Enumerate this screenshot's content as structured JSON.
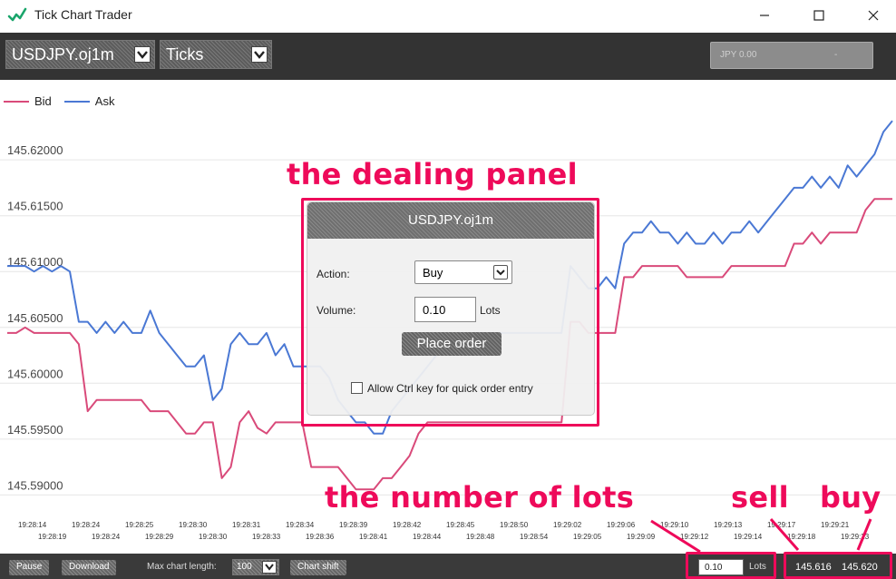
{
  "window": {
    "title": "Tick Chart Trader",
    "controls": {
      "minimize": "—",
      "maximize": "☐",
      "close": "✕"
    }
  },
  "toolbar": {
    "symbol": "USDJPY.oj1m",
    "timeframe": "Ticks",
    "balance": "JPY 0.00",
    "balance_dash": "-"
  },
  "legend": {
    "bid": {
      "label": "Bid",
      "color": "#d94a7a"
    },
    "ask": {
      "label": "Ask",
      "color": "#4a78d4"
    }
  },
  "chart_data": {
    "type": "line",
    "y_ticks": [
      "145.62000",
      "145.61500",
      "145.61000",
      "145.60500",
      "145.60000",
      "145.59500",
      "145.59000"
    ],
    "ylim": [
      145.588,
      145.627
    ],
    "x_labels_top": [
      "19:28:14",
      "19:28:24",
      "19:28:25",
      "19:28:30",
      "19:28:31",
      "19:28:34",
      "19:28:39",
      "19:28:42",
      "19:28:45",
      "19:28:50",
      "19:29:02",
      "19:29:06",
      "19:29:10",
      "19:29:13",
      "19:29:17",
      "19:29:21"
    ],
    "x_labels_bottom": [
      "19:28:19",
      "19:28:24",
      "19:28:29",
      "19:28:30",
      "19:28:33",
      "19:28:36",
      "19:28:41",
      "19:28:44",
      "19:28:48",
      "19:28:54",
      "19:29:05",
      "19:29:09",
      "19:29:12",
      "19:29:14",
      "19:29:18",
      "19:29:23"
    ],
    "series": [
      {
        "name": "Bid",
        "color": "#d94a7a",
        "values": [
          145.6045,
          145.6045,
          145.605,
          145.6045,
          145.6045,
          145.6045,
          145.6045,
          145.6045,
          145.6035,
          145.5975,
          145.5985,
          145.5985,
          145.5985,
          145.5985,
          145.5985,
          145.5985,
          145.5975,
          145.5975,
          145.5975,
          145.5965,
          145.5955,
          145.5955,
          145.5965,
          145.5965,
          145.5915,
          145.5925,
          145.5965,
          145.5975,
          145.596,
          145.5955,
          145.5965,
          145.5965,
          145.5965,
          145.5965,
          145.5925,
          145.5925,
          145.5925,
          145.5925,
          145.5915,
          145.5905,
          145.5905,
          145.5905,
          145.5915,
          145.5915,
          145.5925,
          145.5935,
          145.5955,
          145.5965,
          145.5965,
          145.5965,
          145.5965,
          145.5965,
          145.5965,
          145.5965,
          145.5965,
          145.5965,
          145.5965,
          145.5965,
          145.5965,
          145.5965,
          145.5965,
          145.5965,
          145.5965,
          145.6055,
          145.6055,
          145.6045,
          145.6045,
          145.6045,
          145.6045,
          145.6095,
          145.6095,
          145.6105,
          145.6105,
          145.6105,
          145.6105,
          145.6105,
          145.6095,
          145.6095,
          145.6095,
          145.6095,
          145.6095,
          145.6105,
          145.6105,
          145.6105,
          145.6105,
          145.6105,
          145.6105,
          145.6105,
          145.6125,
          145.6125,
          145.6135,
          145.6125,
          145.6135,
          145.6135,
          145.6135,
          145.6135,
          145.6155,
          145.6165,
          145.6165,
          145.6165
        ]
      },
      {
        "name": "Ask",
        "color": "#4a78d4",
        "values": [
          145.6105,
          145.6105,
          145.6105,
          145.61,
          145.6105,
          145.61,
          145.6105,
          145.61,
          145.6055,
          145.6055,
          145.6045,
          145.6055,
          145.6045,
          145.6055,
          145.6045,
          145.6045,
          145.6065,
          145.6045,
          145.6035,
          145.6025,
          145.6015,
          145.6015,
          145.6025,
          145.5985,
          145.5995,
          145.6035,
          145.6045,
          145.6035,
          145.6035,
          145.6045,
          145.6025,
          145.6035,
          145.6015,
          145.6015,
          145.6015,
          145.6015,
          145.6005,
          145.5985,
          145.5975,
          145.5965,
          145.5965,
          145.5955,
          145.5955,
          145.5975,
          145.5985,
          145.5995,
          145.6005,
          145.6015,
          145.6025,
          145.6035,
          145.6045,
          145.6045,
          145.6045,
          145.6045,
          145.6045,
          145.6045,
          145.6045,
          145.6045,
          145.6045,
          145.6045,
          145.6045,
          145.6045,
          145.6045,
          145.6105,
          145.6095,
          145.6085,
          145.6085,
          145.6095,
          145.6085,
          145.6125,
          145.6135,
          145.6135,
          145.6145,
          145.6135,
          145.6135,
          145.6125,
          145.6135,
          145.6125,
          145.6125,
          145.6135,
          145.6125,
          145.6135,
          145.6135,
          145.6145,
          145.6135,
          145.6145,
          145.6155,
          145.6165,
          145.6175,
          145.6175,
          145.6185,
          145.6175,
          145.6185,
          145.6175,
          145.6195,
          145.6185,
          145.6195,
          145.6205,
          145.6225,
          145.6235
        ]
      }
    ]
  },
  "dealing_panel": {
    "symbol": "USDJPY.oj1m",
    "action_label": "Action:",
    "action_value": "Buy",
    "volume_label": "Volume:",
    "volume_value": "0.10",
    "lots_label": "Lots",
    "place_order": "Place order",
    "quick_entry_label": "Allow Ctrl key for quick order entry"
  },
  "annotations": {
    "dealing_panel": "the dealing panel",
    "lots": "the number of lots",
    "sell": "sell",
    "buy": "buy",
    "color": "#ee0a5a"
  },
  "bottom_bar": {
    "pause": "Pause",
    "download": "Download",
    "max_chart_length_label": "Max chart length:",
    "max_chart_length_value": "100",
    "chart_shift": "Chart shift",
    "lots_value": "0.10",
    "lots_label": "Lots",
    "sell_price": "145.616",
    "buy_price": "145.620"
  }
}
